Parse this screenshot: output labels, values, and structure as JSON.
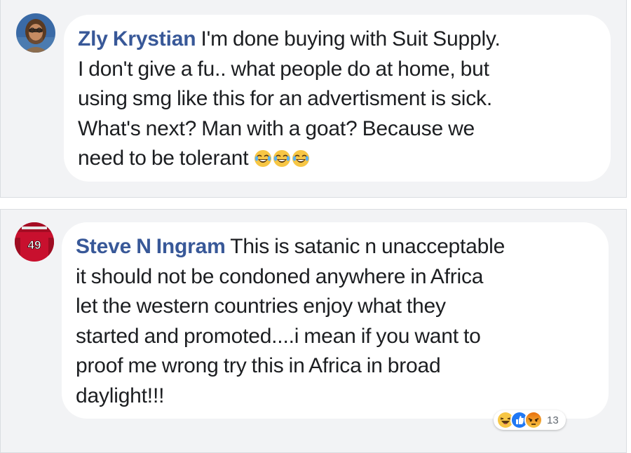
{
  "comments": [
    {
      "author": "Zly Krystian",
      "lines": [
        " I'm done buying with Suit Supply.",
        "I don't give a fu.. what people do at home, but",
        "using smg like this for an advertisment is sick.",
        "What's next? Man with a goat? Because we",
        "need to be tolerant "
      ],
      "emojis": [
        "tears-of-joy-emoji",
        "tears-of-joy-emoji",
        "tears-of-joy-emoji"
      ]
    },
    {
      "author": "Steve N Ingram",
      "lines": [
        " This is satanic n unacceptable",
        "it should not be condoned anywhere in Africa",
        "let the western countries enjoy what they",
        "started and promoted....i mean if you want to",
        "proof me wrong try this in Africa in broad",
        "daylight!!!"
      ],
      "jersey_number": "49",
      "reactions": {
        "icons": [
          "haha-reaction-icon",
          "like-reaction-icon",
          "angry-reaction-icon"
        ],
        "count": "13"
      }
    }
  ],
  "colors": {
    "author_link": "#385898",
    "text": "#1c1e21",
    "card_bg": "#f2f3f5",
    "bubble_bg": "#ffffff",
    "like_blue": "#2078f4",
    "haha_yellow": "#f7c644",
    "angry_orange": "#e9710f",
    "jersey_red": "#c8102e"
  }
}
